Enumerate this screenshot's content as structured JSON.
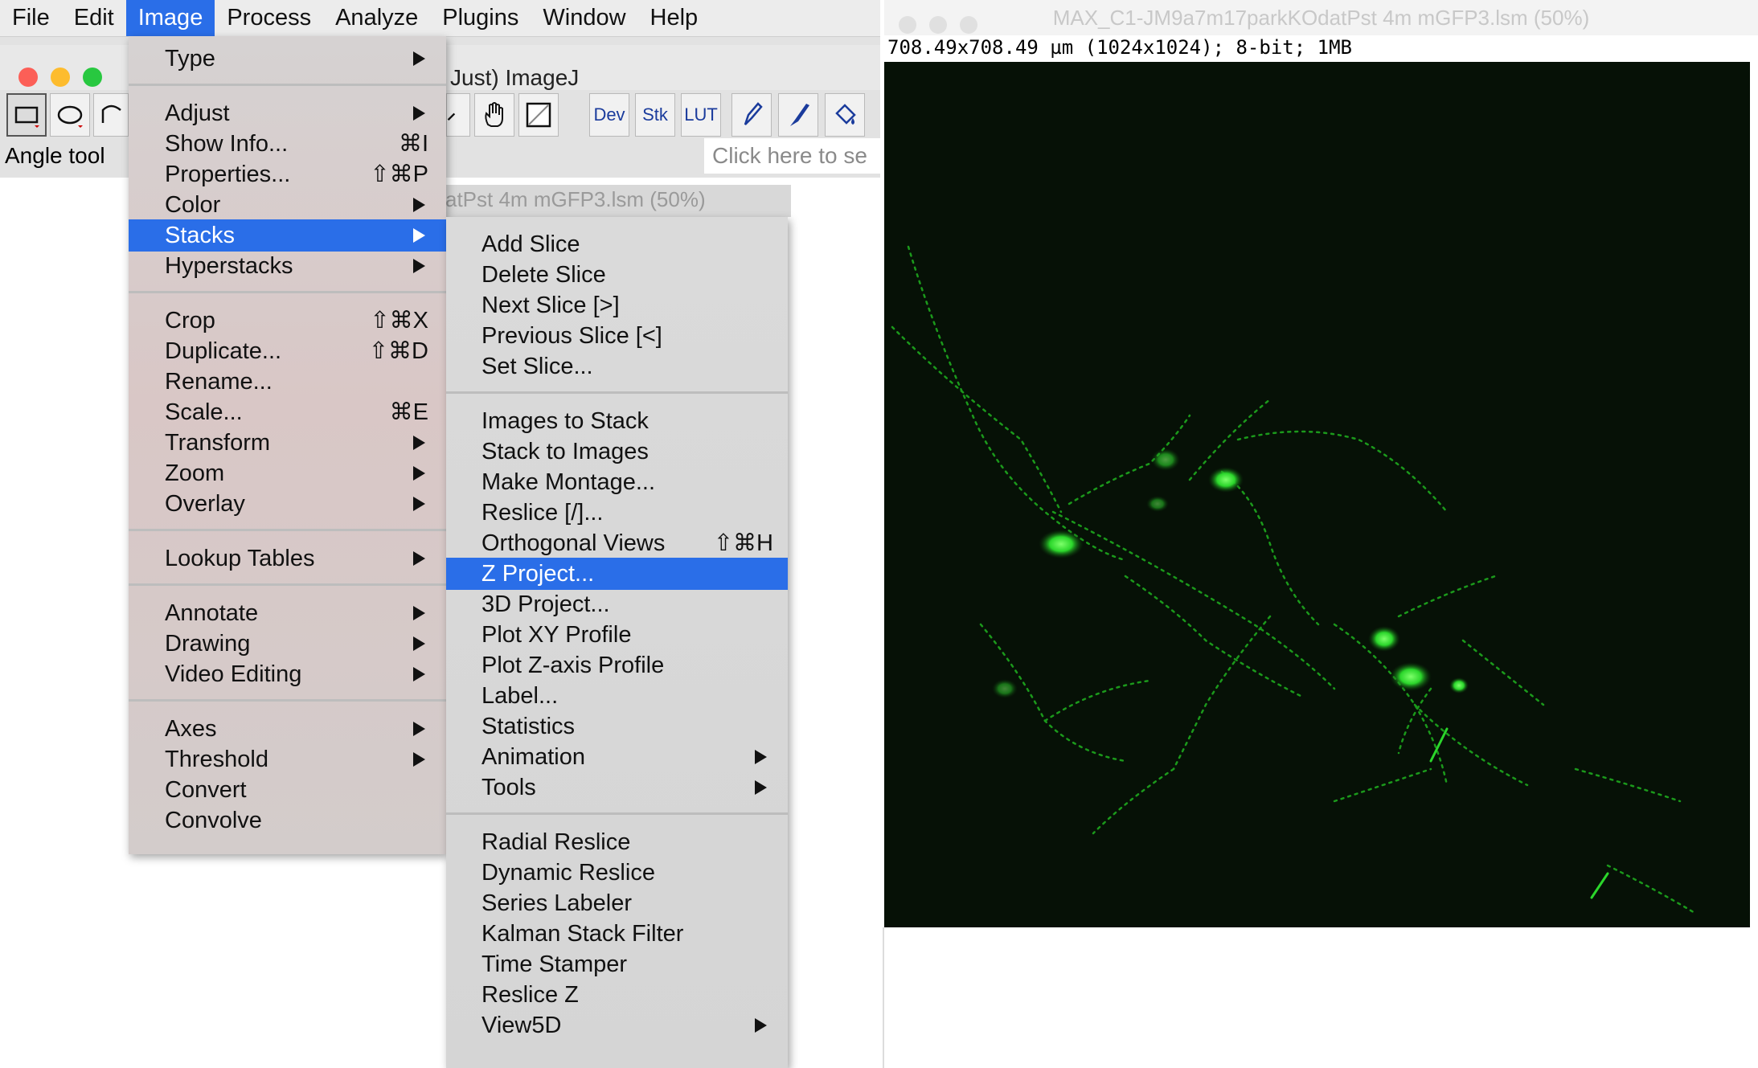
{
  "menubar": {
    "items": [
      "File",
      "Edit",
      "Image",
      "Process",
      "Analyze",
      "Plugins",
      "Window",
      "Help"
    ],
    "active": "Image"
  },
  "imagej_window": {
    "title_visible": "Just) ImageJ",
    "status": "Angle tool",
    "search_hint": "Click here to se",
    "tools": [
      "rectangle-tool",
      "oval-tool",
      "polygon-tool",
      "magnifier-tool",
      "hand-tool",
      "color-picker-tool",
      "Dev",
      "Stk",
      "LUT",
      "pencil-tool",
      "brush-tool",
      "flood-fill-tool"
    ]
  },
  "background_window_title": "atPst 4m mGFP3.lsm (50%)",
  "image_menu": {
    "items": [
      {
        "label": "Type",
        "submenu": true
      },
      {
        "sep": true
      },
      {
        "label": "Adjust",
        "submenu": true
      },
      {
        "label": "Show Info...",
        "shortcut": "⌘I"
      },
      {
        "label": "Properties...",
        "shortcut": "⇧⌘P"
      },
      {
        "label": "Color",
        "submenu": true
      },
      {
        "label": "Stacks",
        "submenu": true,
        "highlighted": true
      },
      {
        "label": "Hyperstacks",
        "submenu": true
      },
      {
        "sep": true
      },
      {
        "label": "Crop",
        "shortcut": "⇧⌘X"
      },
      {
        "label": "Duplicate...",
        "shortcut": "⇧⌘D"
      },
      {
        "label": "Rename..."
      },
      {
        "label": "Scale...",
        "shortcut": "⌘E"
      },
      {
        "label": "Transform",
        "submenu": true
      },
      {
        "label": "Zoom",
        "submenu": true
      },
      {
        "label": "Overlay",
        "submenu": true
      },
      {
        "sep": true
      },
      {
        "label": "Lookup Tables",
        "submenu": true
      },
      {
        "sep": true
      },
      {
        "label": "Annotate",
        "submenu": true
      },
      {
        "label": "Drawing",
        "submenu": true
      },
      {
        "label": "Video Editing",
        "submenu": true
      },
      {
        "sep": true
      },
      {
        "label": "Axes",
        "submenu": true
      },
      {
        "label": "Threshold",
        "submenu": true
      },
      {
        "label": "Convert"
      },
      {
        "label": "Convolve"
      }
    ]
  },
  "stacks_submenu": {
    "items": [
      {
        "label": "Add Slice"
      },
      {
        "label": "Delete Slice"
      },
      {
        "label": "Next Slice [>]"
      },
      {
        "label": "Previous Slice [<]"
      },
      {
        "label": "Set Slice..."
      },
      {
        "sep": true
      },
      {
        "label": "Images to Stack"
      },
      {
        "label": "Stack to Images"
      },
      {
        "label": "Make Montage..."
      },
      {
        "label": "Reslice [/]..."
      },
      {
        "label": "Orthogonal Views",
        "shortcut": "⇧⌘H"
      },
      {
        "label": "Z Project...",
        "highlighted": true
      },
      {
        "label": "3D Project..."
      },
      {
        "label": "Plot XY Profile"
      },
      {
        "label": "Plot Z-axis Profile"
      },
      {
        "label": "Label..."
      },
      {
        "label": "Statistics"
      },
      {
        "label": "Animation",
        "submenu": true
      },
      {
        "label": "Tools",
        "submenu": true
      },
      {
        "sep": true
      },
      {
        "label": "Radial Reslice"
      },
      {
        "label": "Dynamic Reslice"
      },
      {
        "label": "Series Labeler"
      },
      {
        "label": "Kalman Stack Filter"
      },
      {
        "label": "Time Stamper"
      },
      {
        "label": "Reslice Z"
      },
      {
        "label": "View5D",
        "submenu": true
      }
    ]
  },
  "image_window": {
    "title": "MAX_C1-JM9a7m17parkKOdatPst 4m mGFP3.lsm (50%)",
    "info": "708.49x708.49 µm (1024x1024); 8-bit; 1MB"
  },
  "colors": {
    "highlight": "#2a6ee8",
    "image_bg": "#061106",
    "signal": "#2bd62b"
  }
}
